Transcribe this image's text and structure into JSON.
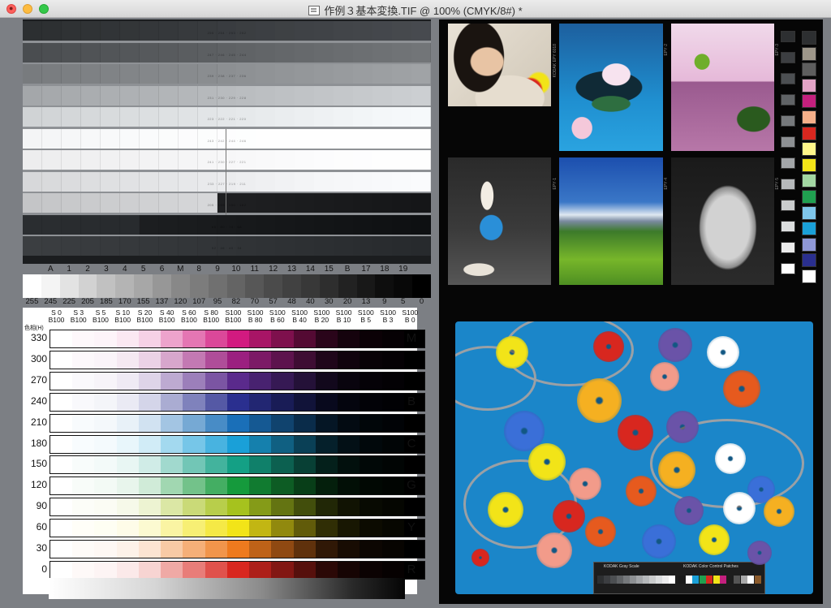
{
  "window": {
    "title": "作例３基本変換.TIF @ 100% (CMYK/8#) *",
    "close_glyph": "●"
  },
  "gray_chart": {
    "row_grays": [
      [
        "#2c2f31",
        "#2d3032",
        "#2f3234",
        "#303335",
        "#313437",
        "#333638",
        "#34373a",
        "#35383b",
        "#373a3d",
        "#383b3e",
        "#393c40",
        "#3b3e41",
        "#3c3f43",
        "#3e4144",
        "#3f4246",
        "#404347",
        "#424549",
        "#43464a",
        "#44474c",
        "#46494d",
        "#474a4f"
      ],
      [
        "#4a4d50",
        "#4c4f52",
        "#4e5154",
        "#505356",
        "#525558",
        "#54575a",
        "#56595c",
        "#585b5e",
        "#5a5d60",
        "#5c5f62",
        "#5e6164",
        "#606366",
        "#626568",
        "#64676a",
        "#66696c",
        "#686b6e",
        "#6a6d70",
        "#6c6f72",
        "#6e7174",
        "#707376",
        "#727578"
      ],
      [
        "#787b7e",
        "#7a7d80",
        "#7c7f82",
        "#7e8184",
        "#808386",
        "#828588",
        "#84878a",
        "#86898c",
        "#888b8e",
        "#8a8d90",
        "#8c8f92",
        "#8e9194",
        "#909396",
        "#929598",
        "#94979a",
        "#96999c",
        "#989b9e",
        "#9a9da0",
        "#9c9fa2",
        "#9ea1a4",
        "#a0a3a6"
      ],
      [
        "#a4a7aa",
        "#a6a9ac",
        "#a8abae",
        "#aaadb0",
        "#acafb2",
        "#aeb1b4",
        "#b0b3b6",
        "#b2b5b8",
        "#b4b7ba",
        "#b6b9bc",
        "#b8bbbe",
        "#babdc0",
        "#bcbfc2",
        "#bec1c4",
        "#c0c3c6",
        "#c2c5c8",
        "#c4c7ca",
        "#c6c9cc",
        "#c8cbce",
        "#cacdd0",
        "#cccfd2"
      ],
      [
        "#d0d3d5",
        "#d2d5d7",
        "#d4d7d9",
        "#d6d9db",
        "#d8dbdd",
        "#dadddf",
        "#dcdfe1",
        "#dee1e3",
        "#e0e3e5",
        "#e2e5e7",
        "#e4e7e9",
        "#e6e9eb",
        "#e8ebed",
        "#eaedef",
        "#eceff1",
        "#eef1f3",
        "#f0f3f5",
        "#f2f5f7",
        "#f4f7f9",
        "#f5f8fa",
        "#f6f9fb"
      ],
      [
        "#f4f5f6",
        "#f5f6f7",
        "#f6f7f8",
        "#f7f8f9",
        "#f8f9fa",
        "#f9fafb",
        "#fafbfc",
        "#fbfcfc",
        "#fcfcfd",
        "#fcfdfd",
        "#fdfdfe",
        "#fdfefe",
        "#fefefe",
        "#fefefe",
        "#fefefe",
        "#fefefe",
        "#fefefe",
        "#fefefe",
        "#fefefe",
        "#fefefe",
        "#fefefe"
      ],
      [
        "#ededee",
        "#eeeeef",
        "#efeff0",
        "#f0f0f1",
        "#f1f1f2",
        "#f2f2f3",
        "#f3f3f4",
        "#f4f4f5",
        "#f5f5f6",
        "#f6f6f7",
        "#f7f7f8",
        "#f8f8f9",
        "#f9f9fa",
        "#fafafb",
        "#fbfbfc",
        "#fcfcfd",
        "#fdfdfd",
        "#fdfdfe",
        "#fefefe",
        "#fefefe",
        "#fefefe"
      ],
      [
        "#d7d8da",
        "#d9dadc",
        "#dbdcde",
        "#dddee0",
        "#dfe0e2",
        "#e1e2e4",
        "#e3e4e6",
        "#e5e6e8",
        "#e7e8ea",
        "#e9eaec",
        "#ebecee",
        "#edeef0",
        "#eff0f2",
        "#f1f2f4",
        "#f3f4f6",
        "#f5f6f8",
        "#f6f7f9",
        "#f7f8fa",
        "#f8f9fb",
        "#f9fafc",
        "#fafbfd"
      ],
      [
        "#c4c5c7",
        "#c6c7c9",
        "#c8c9cb",
        "#cacbcd",
        "#cccdcf",
        "#cecfd1",
        "#d0d1d3",
        "#d2d3d5",
        "#d4d5d7",
        "#d6d7d9",
        "#1e1f21",
        "#1e1f21",
        "#1d1e20",
        "#1c1d1f",
        "#1b1c1e",
        "#1a1b1d",
        "#191a1c",
        "#18191b",
        "#17181a",
        "#161719",
        "#151618"
      ],
      [
        "#2a2d30",
        "#2a2d30",
        "#292c2f",
        "#292c2f",
        "#282b2e",
        "#282b2e",
        "#1c1e20",
        "#1b1d1f",
        "#1a1c1e",
        "#191b1d",
        "#181a1c",
        "#17191b",
        "#16181a",
        "#151719",
        "#141618",
        "#131517",
        "#121416",
        "#111315",
        "#101214",
        "#0f1113",
        "#0e1012"
      ],
      [
        "#3b3e41",
        "#3a3d40",
        "#393c3f",
        "#383b3e",
        "#373a3d",
        "#36393c",
        "#35383b",
        "#34373a",
        "#333639",
        "#323538",
        "#313437",
        "#303336",
        "#2f3235",
        "#2e3134",
        "#2d3033",
        "#2c2f32",
        "#2b2e31",
        "#2a2d30",
        "#292c2f",
        "#282b2e",
        "#272a2d"
      ]
    ],
    "row_numbers": [
      "255 · 254 · 253 · 252",
      "247 · 246 · 245 · 244",
      "239 · 238 · 237 · 236",
      "231 · 230 · 229 · 228",
      "223 · 222 · 221 · 220",
      "243 · 242 · 244 · 246",
      "241 · 230 · 227 · 221",
      "233 · 227 · 219 · 211",
      "205 · 199 · 190 · 182",
      "86 · 80 · 74 · 68",
      "52 · 46 · 40 · 34"
    ]
  },
  "step_wedge": {
    "letters": [
      "A",
      "1",
      "2",
      "3",
      "4",
      "5",
      "6",
      "M",
      "8",
      "9",
      "10",
      "11",
      "12",
      "13",
      "14",
      "15",
      "B",
      "17",
      "18",
      "19"
    ],
    "values": [
      "255",
      "245",
      "225",
      "205",
      "185",
      "170",
      "155",
      "137",
      "120",
      "107",
      "95",
      "82",
      "70",
      "57",
      "48",
      "40",
      "30",
      "20",
      "13",
      "9",
      "5",
      "0"
    ],
    "grays": [
      "#ffffff",
      "#f4f4f4",
      "#e3e3e3",
      "#d2d2d2",
      "#c1c1c1",
      "#b4b4b4",
      "#a7a7a7",
      "#979797",
      "#888888",
      "#7c7c7c",
      "#707070",
      "#646464",
      "#575757",
      "#4b4b4b",
      "#414141",
      "#383838",
      "#2e2e2e",
      "#222222",
      "#181818",
      "#0e0e0e",
      "#080808",
      "#000000"
    ]
  },
  "color_chart": {
    "headers": [
      [
        "S 0",
        "B100"
      ],
      [
        "S 3",
        "B100"
      ],
      [
        "S 5",
        "B100"
      ],
      [
        "S 10",
        "B100"
      ],
      [
        "S 20",
        "B100"
      ],
      [
        "S 40",
        "B100"
      ],
      [
        "S 60",
        "B100"
      ],
      [
        "S 80",
        "B100"
      ],
      [
        "S100",
        "B100"
      ],
      [
        "S100",
        "B 80"
      ],
      [
        "S100",
        "B 60"
      ],
      [
        "S100",
        "B 40"
      ],
      [
        "S100",
        "B 20"
      ],
      [
        "S100",
        "B 10"
      ],
      [
        "S100",
        "B 5"
      ],
      [
        "S100",
        "B 3"
      ],
      [
        "S100",
        "B 0"
      ]
    ],
    "hue_axis_label": "色相(H)",
    "hues": [
      "330",
      "300",
      "270",
      "240",
      "210",
      "180",
      "150",
      "120",
      "90",
      "60",
      "30",
      "0"
    ],
    "hue_colors": [
      "#d21a80",
      "#9b2080",
      "#5a2a8c",
      "#2a2f8f",
      "#1a6fb8",
      "#1aa0d8",
      "#14a085",
      "#159a3c",
      "#a6c21e",
      "#f2e418",
      "#ee7a1e",
      "#d8271f"
    ],
    "letters": [
      {
        "text": "M",
        "row": 0
      },
      {
        "text": "B",
        "row": 3
      },
      {
        "text": "C",
        "row": 5
      },
      {
        "text": "G",
        "row": 7
      },
      {
        "text": "Y",
        "row": 9
      },
      {
        "text": "R",
        "row": 11
      }
    ]
  },
  "photos": {
    "film_label": "KODAK EPY 6018",
    "frame_codes": [
      "EPY·1",
      "EPY·2",
      "EPY·3",
      "EPY·4",
      "EPY·5"
    ]
  },
  "control_strip": {
    "colors": [
      "#2d2f31",
      "#9e978a",
      "#5e5e5e",
      "#e3a3c6",
      "#c4207e",
      "#f5b08a",
      "#d8271f",
      "#fff68a",
      "#f2e418",
      "#a2d6a2",
      "#20a050",
      "#7fc6ea",
      "#1aa0d8",
      "#8f98d6",
      "#2a2f8f",
      "#ffffff"
    ],
    "grays": [
      "#2d2f31",
      "#3c3e41",
      "#4c4f52",
      "#606366",
      "#76797c",
      "#8d9093",
      "#a3a6a9",
      "#b6b9bb",
      "#cacccd",
      "#dcdedf",
      "#ececec",
      "#ffffff"
    ]
  },
  "flower_target": {
    "gray_scale_label": "KODAK Gray Scale",
    "color_patches_label": "KODAK Color Control Patches",
    "patch_colors": [
      "#1a1a1a",
      "#ffffff",
      "#1aa0d8",
      "#20a050",
      "#d8271f",
      "#f2e418",
      "#c4207e",
      "#1d1d1d",
      "#555555",
      "#aaaaaa",
      "#ffffff",
      "#8b5a2b"
    ],
    "flowers": [
      {
        "c": "#f2e418",
        "name": "yellow-rose"
      },
      {
        "c": "#d8271f",
        "name": "red-rose"
      },
      {
        "c": "#6a53a8",
        "name": "purple-rose"
      },
      {
        "c": "#ffffff",
        "name": "white-rose"
      },
      {
        "c": "#f5b021",
        "name": "sunflower"
      },
      {
        "c": "#f29b8a",
        "name": "pink-rose"
      },
      {
        "c": "#e65a1e",
        "name": "orange-poppy"
      },
      {
        "c": "#3a6fd8",
        "name": "blue-anemone"
      }
    ]
  }
}
